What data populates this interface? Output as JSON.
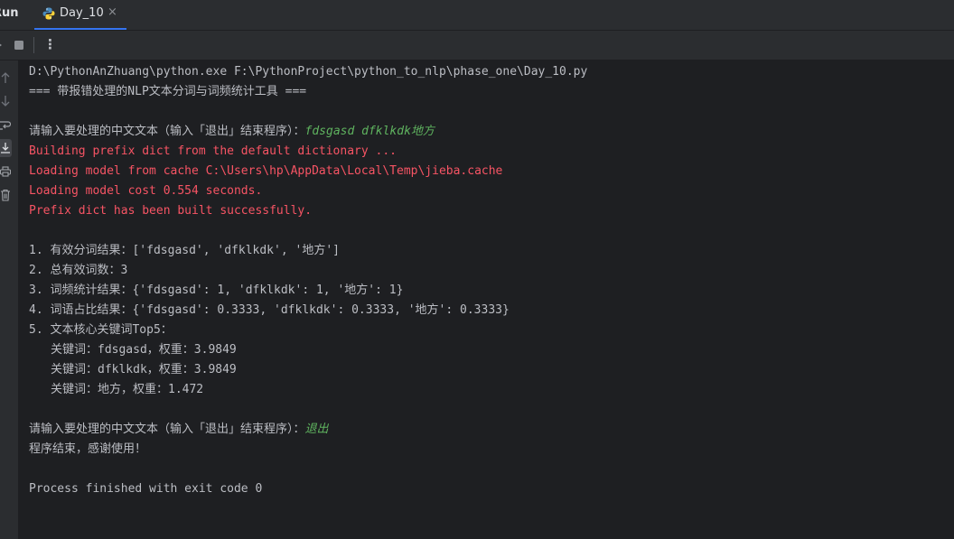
{
  "tool_window": {
    "title": "Run"
  },
  "tab": {
    "label": "Day_10",
    "close": "×",
    "icon": "python-icon"
  },
  "toolbar": {
    "more": "⋮"
  },
  "console": {
    "command": "D:\\PythonAnZhuang\\python.exe F:\\PythonProject\\python_to_nlp\\phase_one\\Day_10.py",
    "banner": "=== 带报错处理的NLP文本分词与词频统计工具 ===",
    "prompt1": "请输入要处理的中文文本（输入「退出」结束程序）：",
    "input1": "fdsgasd dfklkdk地方",
    "log1": "Building prefix dict from the default dictionary ...",
    "log2": "Loading model from cache C:\\Users\\hp\\AppData\\Local\\Temp\\jieba.cache",
    "log3": "Loading model cost 0.554 seconds.",
    "log4": "Prefix dict has been built successfully.",
    "r1": "1. 有效分词结果：['fdsgasd', 'dfklkdk', '地方']",
    "r2": "2. 总有效词数：3",
    "r3": "3. 词频统计结果：{'fdsgasd': 1, 'dfklkdk': 1, '地方': 1}",
    "r4": "4. 词语占比结果：{'fdsgasd': 0.3333, 'dfklkdk': 0.3333, '地方': 0.3333}",
    "r5": "5. 文本核心关键词Top5：",
    "k1": "关键词：fdsgasd，权重：3.9849",
    "k2": "关键词：dfklkdk，权重：3.9849",
    "k3": "关键词：地方，权重：1.472",
    "prompt2": "请输入要处理的中文文本（输入「退出」结束程序）：",
    "input2": "退出",
    "goodbye": "程序结束，感谢使用！",
    "exit": "Process finished with exit code 0"
  },
  "colors": {
    "error": "#f75464",
    "user_input": "#5fb35f",
    "text": "#bcbec4",
    "accent": "#3574f0"
  }
}
